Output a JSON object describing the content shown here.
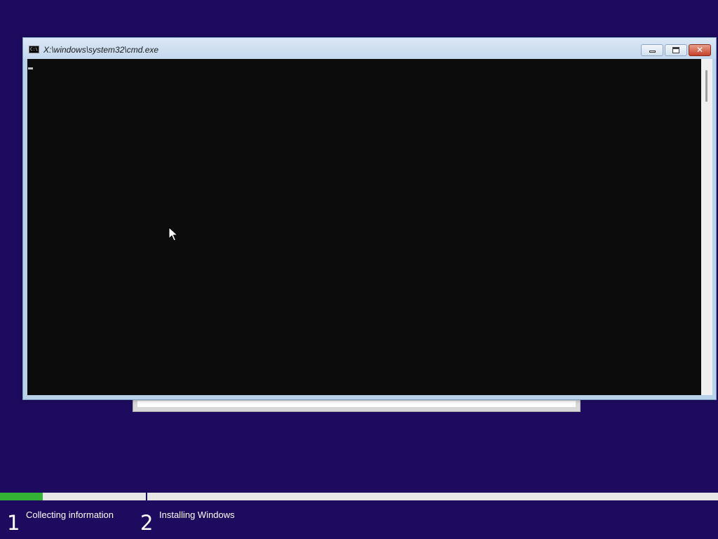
{
  "colors": {
    "desktop_background": "#1e0b5f",
    "console_background": "#0c0c0c",
    "progress_fill": "#34b233",
    "progress_track": "#e6e6e6",
    "close_button": "#c7402a"
  },
  "cmd_window": {
    "title": "X:\\windows\\system32\\cmd.exe",
    "icon": "cmd-icon",
    "icon_text": "C:\\",
    "buttons": {
      "minimize": "minimize-icon",
      "maximize": "maximize-icon",
      "close": "close-icon",
      "close_glyph": "✕"
    },
    "console_text": ""
  },
  "install_progress": {
    "fraction": 0.06,
    "steps": [
      {
        "number": "1",
        "label": "Collecting information"
      },
      {
        "number": "2",
        "label": "Installing Windows"
      }
    ]
  }
}
